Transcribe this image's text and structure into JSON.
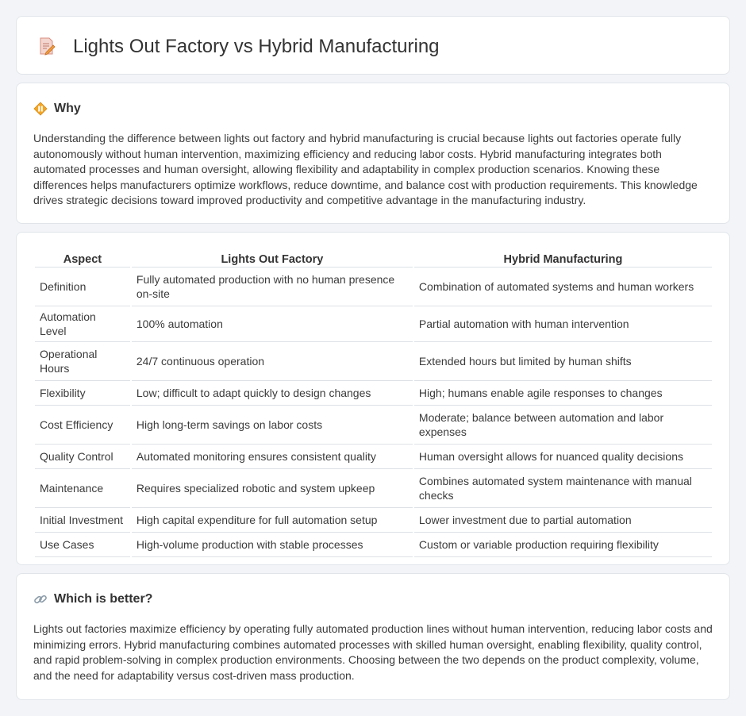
{
  "header": {
    "title": "Lights Out Factory vs Hybrid Manufacturing",
    "icon": "document-pencil-icon"
  },
  "why": {
    "heading": "Why",
    "icon": "warning-diamond-icon",
    "text": "Understanding the difference between lights out factory and hybrid manufacturing is crucial because lights out factories operate fully autonomously without human intervention, maximizing efficiency and reducing labor costs. Hybrid manufacturing integrates both automated processes and human oversight, allowing flexibility and adaptability in complex production scenarios. Knowing these differences helps manufacturers optimize workflows, reduce downtime, and balance cost with production requirements. This knowledge drives strategic decisions toward improved productivity and competitive advantage in the manufacturing industry."
  },
  "table": {
    "headers": [
      "Aspect",
      "Lights Out Factory",
      "Hybrid Manufacturing"
    ],
    "rows": [
      [
        "Definition",
        "Fully automated production with no human presence on-site",
        "Combination of automated systems and human workers"
      ],
      [
        "Automation Level",
        "100% automation",
        "Partial automation with human intervention"
      ],
      [
        "Operational Hours",
        "24/7 continuous operation",
        "Extended hours but limited by human shifts"
      ],
      [
        "Flexibility",
        "Low; difficult to adapt quickly to design changes",
        "High; humans enable agile responses to changes"
      ],
      [
        "Cost Efficiency",
        "High long-term savings on labor costs",
        "Moderate; balance between automation and labor expenses"
      ],
      [
        "Quality Control",
        "Automated monitoring ensures consistent quality",
        "Human oversight allows for nuanced quality decisions"
      ],
      [
        "Maintenance",
        "Requires specialized robotic and system upkeep",
        "Combines automated system maintenance with manual checks"
      ],
      [
        "Initial Investment",
        "High capital expenditure for full automation setup",
        "Lower investment due to partial automation"
      ],
      [
        "Use Cases",
        "High-volume production with stable processes",
        "Custom or variable production requiring flexibility"
      ]
    ]
  },
  "better": {
    "heading": "Which is better?",
    "icon": "link-icon",
    "text": "Lights out factories maximize efficiency by operating fully automated production lines without human intervention, reducing labor costs and minimizing errors. Hybrid manufacturing combines automated processes with skilled human oversight, enabling flexibility, quality control, and rapid problem-solving in complex production environments. Choosing between the two depends on the product complexity, volume, and the need for adaptability versus cost-driven mass production."
  }
}
